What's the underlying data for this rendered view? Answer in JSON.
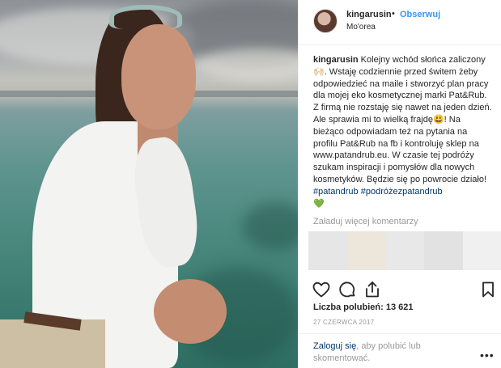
{
  "post": {
    "username": "kingarusin",
    "separator": "•",
    "follow_label": "Obserwuj",
    "location": "Mo'orea",
    "caption": {
      "username": "kingarusin",
      "text_part1": " Kolejny wchód słońca zaliczony🙌🏻. Wstaję codziennie przed świtem żeby odpowiedzieć na maile i stworzyć plan pracy dla mojej eko kosmetycznej marki Pat&Rub. Z firmą nie rozstaję się nawet na jeden dzień. Ale sprawia mi to wielką frajdę😃! Na bieżąco odpowiadam też na pytania na profilu Pat&Rub na fb i kontroluję sklep na www.patandrub.eu. W czasie tej podróży szukam inspiracji i pomysłów dla nowych kosmetyków. Będzie się po powrocie działo! ",
      "hashtag1": "#patandrub",
      "hashtag2": "#podróżezpatandrub",
      "emoji_end": "💚"
    },
    "load_more_comments": "Załaduj więcej komentarzy",
    "likes_label": "Liczba polubień: 13 621",
    "date": "27 CZERWCA 2017",
    "login": {
      "link": "Zaloguj się",
      "text": ", aby polubić lub skomentować."
    },
    "more_label": "•••"
  },
  "colors": {
    "link_blue": "#3897f0",
    "hashtag": "#003569",
    "muted": "#999999",
    "text": "#262626",
    "border": "#efefef"
  },
  "icons": [
    "heart-icon",
    "comment-icon",
    "share-icon",
    "bookmark-icon",
    "more-icon"
  ]
}
